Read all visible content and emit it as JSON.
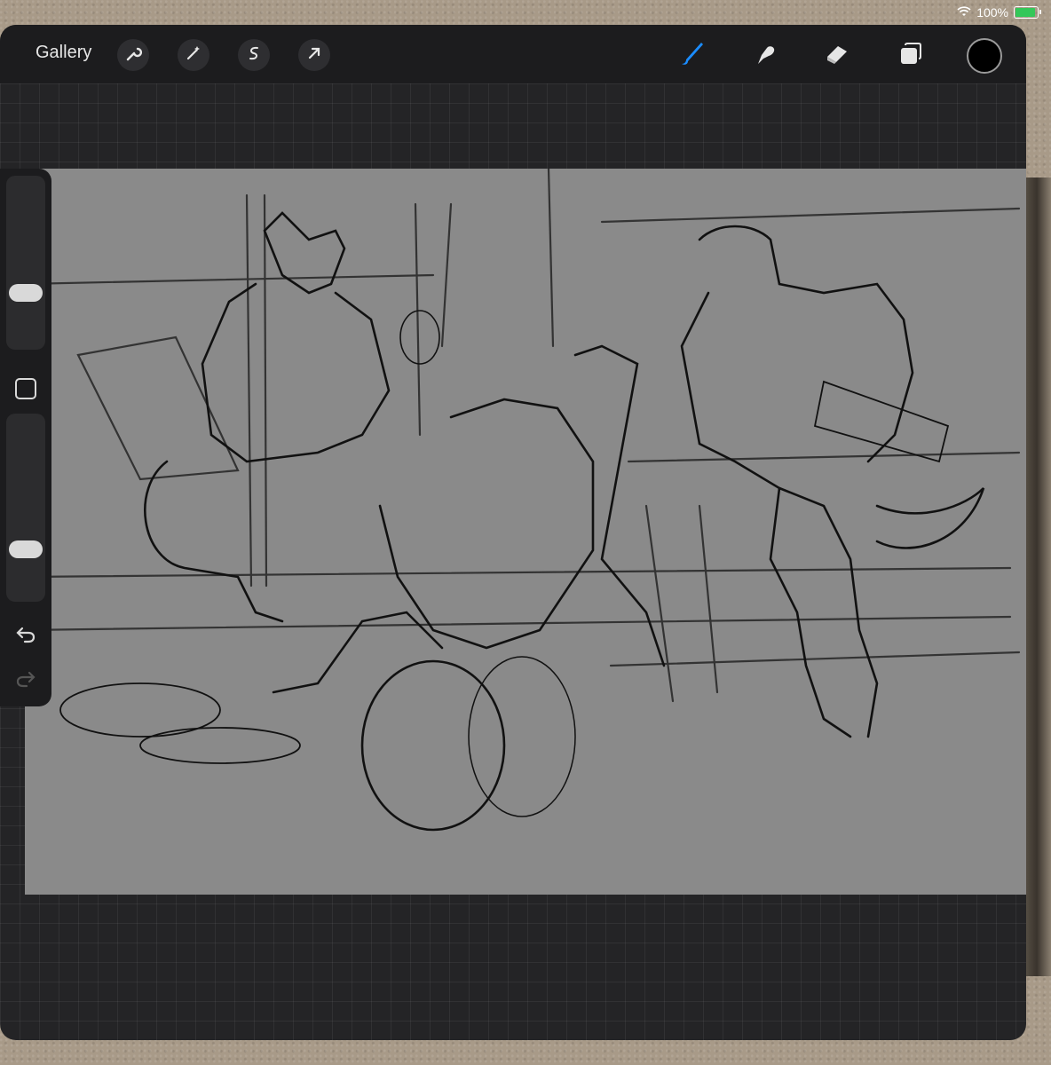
{
  "status": {
    "battery_percent": "100%",
    "battery_level": 1.0
  },
  "toolbar": {
    "gallery_label": "Gallery",
    "left_tools": [
      "wrench-icon",
      "magic-wand-icon",
      "selection-icon",
      "transform-arrow-icon"
    ],
    "right_tools": [
      "brush-icon",
      "smudge-icon",
      "eraser-icon",
      "layers-icon"
    ],
    "active_tool": "brush-icon",
    "active_color": "#000000",
    "accent_color": "#1a8cff"
  },
  "sidebar": {
    "brush_size_level": 0.3,
    "opacity_level": 0.25,
    "controls": [
      "brush-size-slider",
      "modify-button",
      "opacity-slider",
      "undo-icon",
      "redo-icon"
    ]
  },
  "canvas": {
    "background": "#8a8a8a",
    "content": "sketch"
  }
}
